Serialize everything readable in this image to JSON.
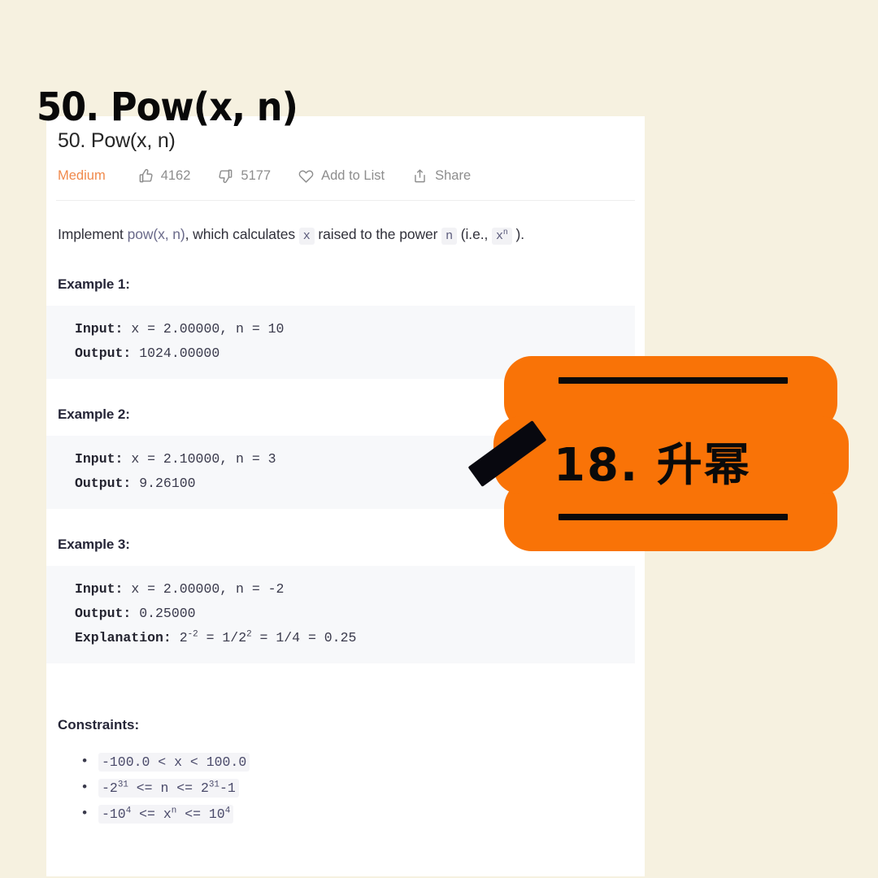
{
  "page": {
    "background_color": "#F6F1E0",
    "card_background": "#FFFFFF"
  },
  "problem": {
    "title": "50. Pow(x, n)",
    "difficulty": "Medium",
    "difficulty_color": "#F0894B",
    "likes": "4162",
    "dislikes": "5177",
    "add_to_list_label": "Add to List",
    "share_label": "Share"
  },
  "description": {
    "part1": "Implement ",
    "fn": "pow(x, n)",
    "part2": ", which calculates ",
    "code_x": "x",
    "part3": " raised to the power ",
    "code_n": "n",
    "part4": " (i.e., ",
    "code_xn_base": "x",
    "code_xn_sup": "n",
    "part5": " )."
  },
  "examples": [
    {
      "heading": "Example 1:",
      "input_label": "Input:",
      "input_value": " x = 2.00000, n = 10",
      "output_label": "Output:",
      "output_value": " 1024.00000"
    },
    {
      "heading": "Example 2:",
      "input_label": "Input:",
      "input_value": " x = 2.10000, n = 3",
      "output_label": "Output:",
      "output_value": " 9.26100"
    },
    {
      "heading": "Example 3:",
      "input_label": "Input:",
      "input_value": " x = 2.00000, n = -2",
      "output_label": "Output:",
      "output_value": " 0.25000",
      "explanation_label": "Explanation:",
      "explanation_value": " 2-2 = 1/22 = 1/4 = 0.25"
    }
  ],
  "constraints": {
    "heading": "Constraints:",
    "items": [
      "-100.0 < x < 100.0",
      "-231 <= n <= 231-1",
      "-104 <= xn <= 104"
    ]
  },
  "overlay": {
    "title": "50. Pow(x, n)",
    "badge_text": "18. 升幂",
    "badge_color": "#F97307",
    "badge_ink": "#0A0A0A"
  },
  "icons": {
    "thumbs_up": "thumbs-up-icon",
    "thumbs_down": "thumbs-down-icon",
    "heart": "heart-icon",
    "share": "share-icon"
  }
}
